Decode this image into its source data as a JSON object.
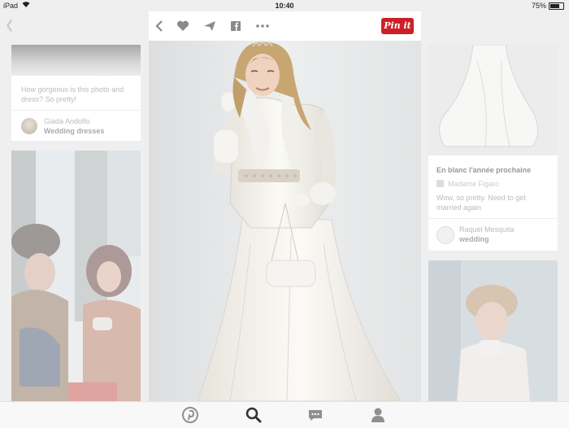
{
  "status_bar": {
    "device": "iPad",
    "time": "10:40",
    "battery": "75%"
  },
  "left_column": {
    "card1": {
      "description": "How gorgeous is this photo and dress? So pretty!",
      "pinner_name": "Giada Andolfo",
      "board_name": "Wedding dresses"
    }
  },
  "right_column": {
    "card1": {
      "title": "En blanc l'année prochaine",
      "source": "Madame Figaro",
      "description": "Wow, so pretty. Need to get married again",
      "pinner_name": "Raquel Mesquita",
      "board_name": "wedding"
    }
  },
  "pin_toolbar": {
    "pin_it_label": "Pin it",
    "icons": [
      "back-icon",
      "heart-icon",
      "send-icon",
      "facebook-icon",
      "more-icon"
    ]
  },
  "tab_bar": {
    "tabs": [
      "pinterest-home",
      "search",
      "messages",
      "profile"
    ]
  },
  "colors": {
    "pin_it_red": "#cb2027",
    "background": "#efefef"
  }
}
